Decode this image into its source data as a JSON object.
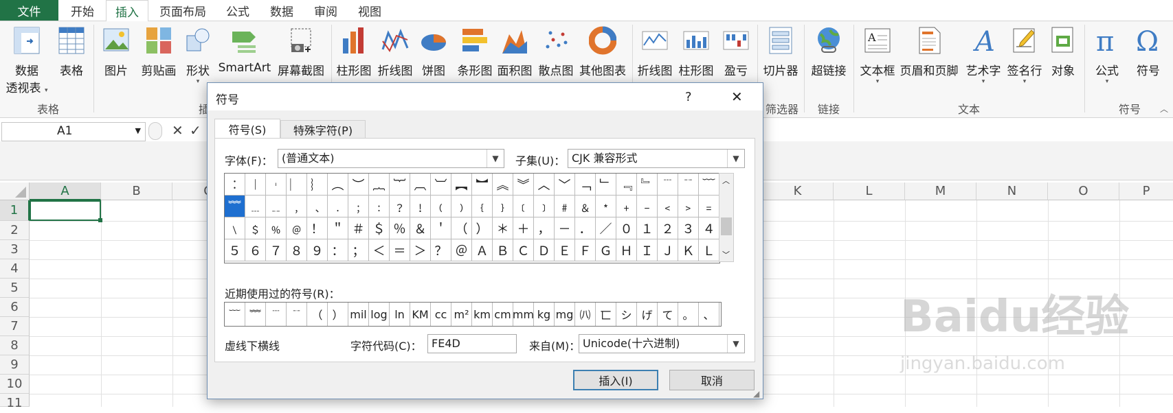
{
  "menubar": {
    "file": "文件",
    "tabs": [
      "开始",
      "插入",
      "页面布局",
      "公式",
      "数据",
      "审阅",
      "视图"
    ]
  },
  "ribbon": {
    "buttons": [
      {
        "label": "数据",
        "label2": "透视表"
      },
      {
        "label": "表格"
      },
      {
        "label": "图片"
      },
      {
        "label": "剪贴画"
      },
      {
        "label": "形状"
      },
      {
        "label": "SmartArt"
      },
      {
        "label": "屏幕截图"
      },
      {
        "label": "柱形图"
      },
      {
        "label": "折线图"
      },
      {
        "label": "饼图"
      },
      {
        "label": "条形图"
      },
      {
        "label": "面积图"
      },
      {
        "label": "散点图"
      },
      {
        "label": "其他图表"
      },
      {
        "label": "折线图"
      },
      {
        "label": "柱形图"
      },
      {
        "label": "盈亏"
      },
      {
        "label": "切片器"
      },
      {
        "label": "超链接"
      },
      {
        "label": "文本框"
      },
      {
        "label": "页眉和页脚"
      },
      {
        "label": "艺术字"
      },
      {
        "label": "签名行"
      },
      {
        "label": "对象"
      },
      {
        "label": "公式"
      },
      {
        "label": "符号"
      }
    ],
    "groups": [
      "表格",
      "插",
      "筛选器",
      "链接",
      "文本",
      "符号"
    ]
  },
  "formula_bar": {
    "name_box": "A1"
  },
  "sheet": {
    "columns": [
      "A",
      "B",
      "C",
      "",
      "",
      "",
      "",
      "",
      "",
      "",
      "K",
      "L",
      "M",
      "N",
      "O",
      "P"
    ],
    "rows": [
      "1",
      "2",
      "3",
      "4",
      "5",
      "6",
      "7",
      "8",
      "9",
      "10",
      "11"
    ]
  },
  "dialog": {
    "title": "符号",
    "help": "?",
    "close": "✕",
    "tabs": [
      "符号(S)",
      "特殊字符(P)"
    ],
    "font_label": "字体(F)：",
    "font_value": "(普通文本)",
    "subset_label": "子集(U)：",
    "subset_value": "CJK 兼容形式",
    "symbols": [
      "︰",
      "︱",
      "︲",
      "︳",
      "︴",
      "︵",
      "︶",
      "︷",
      "︸",
      "︹",
      "︺",
      "︻",
      "︼",
      "︽",
      "︾",
      "︿",
      "﹀",
      "﹁",
      "﹂",
      "﹃",
      "﹄",
      "﹉",
      "﹊",
      "﹋",
      "﹌",
      "﹍",
      "﹎",
      "﹐",
      "﹑",
      "﹒",
      "﹔",
      "﹕",
      "﹖",
      "﹗",
      "﹙",
      "﹚",
      "﹛",
      "﹜",
      "﹝",
      "﹞",
      "﹟",
      "﹠",
      "﹡",
      "﹢",
      "﹣",
      "﹤",
      "﹥",
      "﹦",
      "﹨",
      "﹩",
      "﹪",
      "﹫",
      "！",
      "＂",
      "＃",
      "＄",
      "％",
      "＆",
      "＇",
      "（",
      "）",
      "＊",
      "＋",
      "，",
      "－",
      "．",
      "／",
      "０",
      "１",
      "２",
      "３",
      "４",
      "５",
      "６",
      "７",
      "８",
      "９",
      "：",
      "；",
      "＜",
      "＝",
      "＞",
      "？",
      "＠",
      "Ａ",
      "Ｂ",
      "Ｃ",
      "Ｄ",
      "Ｅ",
      "Ｆ",
      "Ｇ",
      "Ｈ",
      "Ｉ",
      "Ｊ",
      "Ｋ",
      "Ｌ"
    ],
    "recent_label": "近期使用过的符号(R)：",
    "recent": [
      "﹋",
      "﹌",
      "﹉",
      "﹊",
      "（",
      "）",
      "mil",
      "log",
      "ln",
      "KM",
      "cc",
      "m²",
      "km",
      "cm",
      "mm",
      "kg",
      "mg",
      "㈧",
      "匸",
      "シ",
      "げ",
      "て",
      "。",
      "、"
    ],
    "char_name": "虚线下横线",
    "code_label": "字符代码(C)：",
    "code_value": "FE4D",
    "from_label": "来自(M)：",
    "from_value": "Unicode(十六进制)",
    "insert": "插入(I)",
    "cancel": "取消"
  },
  "watermark": {
    "brand": "Baidu经验",
    "url": "jingyan.baidu.com"
  }
}
